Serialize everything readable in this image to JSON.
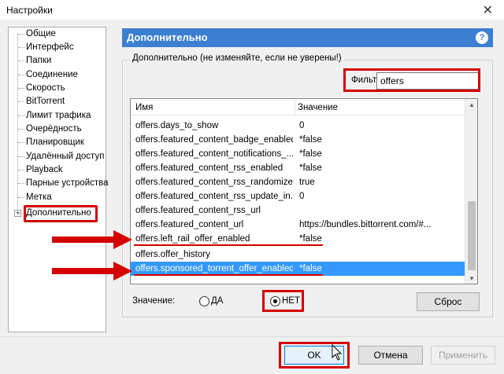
{
  "window": {
    "title": "Настройки",
    "close_glyph": "✕"
  },
  "sidebar": {
    "items": [
      {
        "label": "Общие"
      },
      {
        "label": "Интерфейс"
      },
      {
        "label": "Папки"
      },
      {
        "label": "Соединение"
      },
      {
        "label": "Скорость"
      },
      {
        "label": "BitTorrent"
      },
      {
        "label": "Лимит трафика"
      },
      {
        "label": "Очерёдность"
      },
      {
        "label": "Планировщик"
      },
      {
        "label": "Удалённый доступ"
      },
      {
        "label": "Playback"
      },
      {
        "label": "Парные устройства"
      },
      {
        "label": "Метка"
      },
      {
        "label": "Дополнительно"
      }
    ],
    "expander_glyph": "+"
  },
  "header": {
    "title": "Дополнительно",
    "help_glyph": "?"
  },
  "group": {
    "label": "Дополнительно (не изменяйте, если не уверены!)"
  },
  "filter": {
    "label": "Фильтр",
    "value": "offers"
  },
  "table": {
    "columns": [
      "Имя",
      "Значение"
    ],
    "rows": [
      {
        "name": "offers.days_to_show",
        "value": "0"
      },
      {
        "name": "offers.featured_content_badge_enabled",
        "value": "*false"
      },
      {
        "name": "offers.featured_content_notifications_...",
        "value": "*false"
      },
      {
        "name": "offers.featured_content_rss_enabled",
        "value": "*false"
      },
      {
        "name": "offers.featured_content_rss_randomize",
        "value": "true"
      },
      {
        "name": "offers.featured_content_rss_update_in...",
        "value": "0"
      },
      {
        "name": "offers.featured_content_rss_url",
        "value": ""
      },
      {
        "name": "offers.featured_content_url",
        "value": "https://bundles.bittorrent.com/#..."
      },
      {
        "name": "offers.left_rail_offer_enabled",
        "value": "*false"
      },
      {
        "name": "offers.offer_history",
        "value": ""
      },
      {
        "name": "offers.sponsored_torrent_offer_enabled",
        "value": "*false"
      }
    ],
    "selected_row": 10,
    "scroll_up_glyph": "▲",
    "scroll_down_glyph": "▼"
  },
  "value_editor": {
    "label": "Значение:",
    "yes_label": "ДА",
    "no_label": "НЕТ",
    "selected": "НЕТ",
    "reset_label": "Сброс"
  },
  "footer": {
    "ok_label": "OK",
    "cancel_label": "Отмена",
    "apply_label": "Применить"
  },
  "colors": {
    "accent": "#3b7fd1",
    "selection": "#3399ff",
    "annotation_red": "#d40000"
  }
}
